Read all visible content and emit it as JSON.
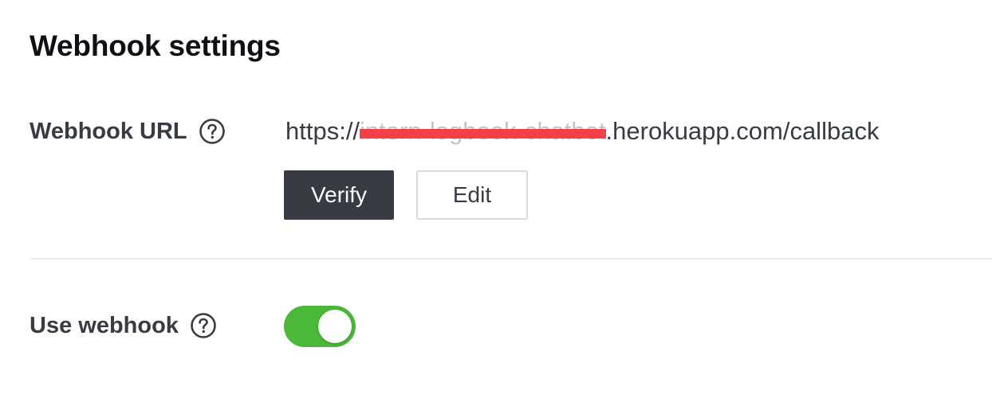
{
  "page": {
    "title": "Webhook settings"
  },
  "webhook_url": {
    "label": "Webhook URL",
    "help_icon": "help-circle-icon",
    "url_prefix": "https://",
    "url_redacted": "intern-logbook-chatbot",
    "url_suffix": ".herokuapp.com/callback",
    "verify_label": "Verify",
    "edit_label": "Edit"
  },
  "use_webhook": {
    "label": "Use webhook",
    "help_icon": "help-circle-icon",
    "enabled": true
  },
  "colors": {
    "toggle_on": "#4cb83a",
    "verify_button": "#383b44",
    "redaction": "#f34048"
  }
}
